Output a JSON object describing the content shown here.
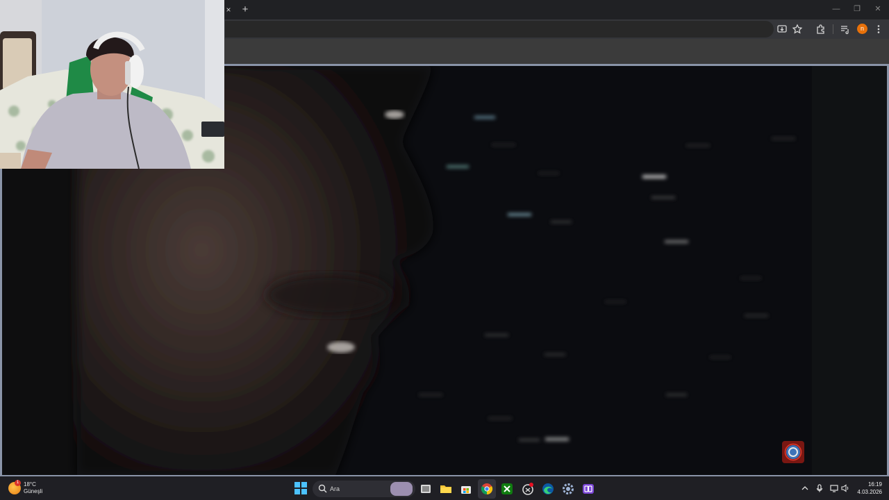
{
  "browser": {
    "tab_close_glyph": "×",
    "new_tab_glyph": "+",
    "window_controls": {
      "minimize": "—",
      "maximize": "❐",
      "close": "✕"
    },
    "toolbar_icons": [
      "install-icon",
      "star-icon",
      "extensions-icon",
      "media-controls-icon",
      "profile-avatar",
      "menu-icon"
    ],
    "profile_initial": "n",
    "profile_color": "#e8710a"
  },
  "taskbar": {
    "weather": {
      "temperature": "18°C",
      "condition": "Güneşli",
      "badge": "1"
    },
    "search": {
      "placeholder": "Ara"
    },
    "pinned_apps": [
      "task-view",
      "file-explorer",
      "microsoft-store",
      "chrome",
      "xbox",
      "snipping-tool",
      "edge",
      "settings",
      "photos"
    ],
    "clock": {
      "time": "16:19",
      "date": "4.03.2026"
    }
  },
  "colors": {
    "taskbar_bg": "#1f1f24",
    "accent": "#4cc2ff",
    "video_bg": "#0b0c10"
  }
}
